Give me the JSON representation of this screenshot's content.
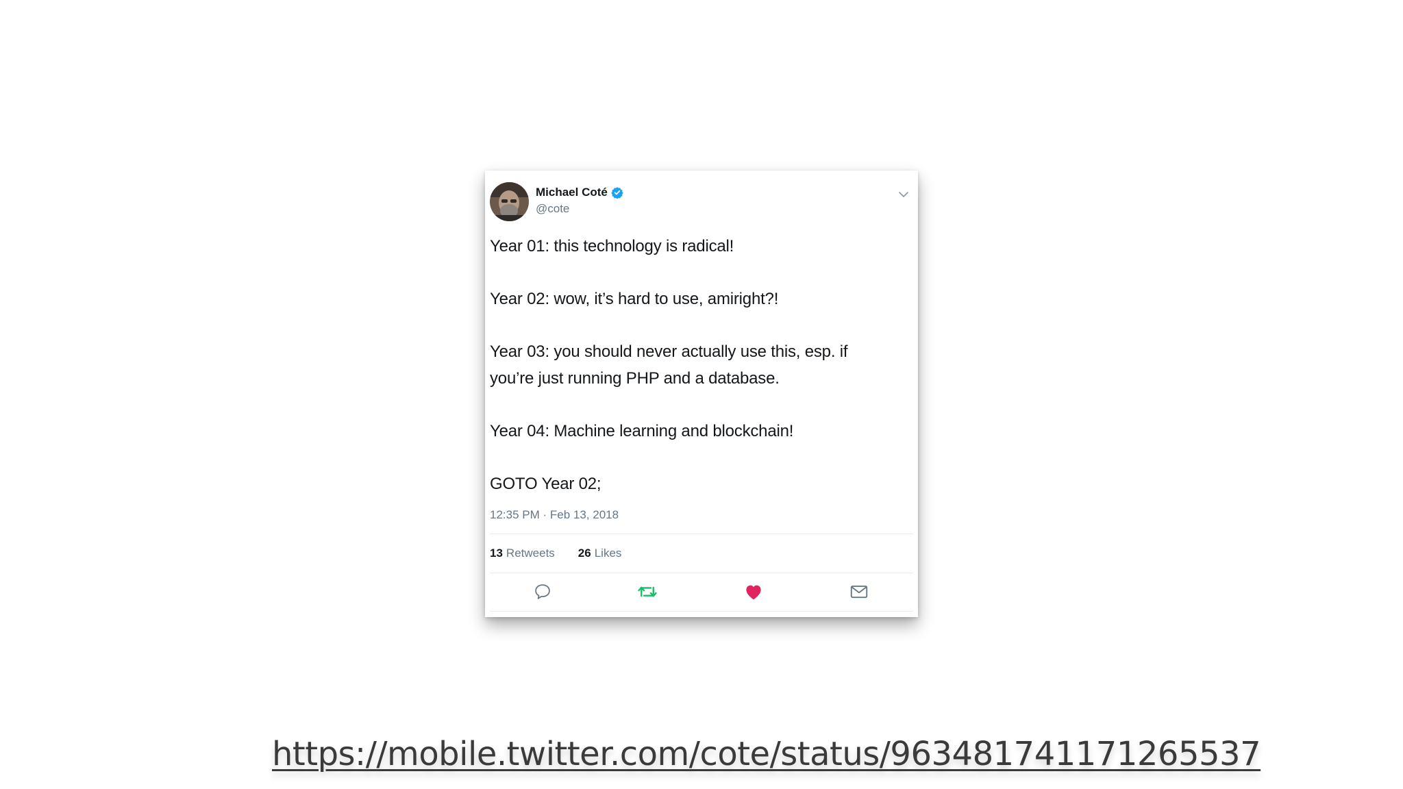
{
  "tweet": {
    "author_name": "Michael Coté",
    "handle": "@cote",
    "lines": [
      "Year 01: this technology is radical!",
      "",
      "Year 02: wow, it’s hard to use, amiright?!",
      "",
      "Year 03: you should never actually use this, esp. if",
      "you’re just running PHP and a database.",
      "",
      "Year 04: Machine learning and blockchain!",
      "",
      "GOTO Year 02;"
    ],
    "timestamp": "12:35 PM · Feb 13, 2018",
    "retweets_count": "13",
    "retweets_label": "Retweets",
    "likes_count": "26",
    "likes_label": "Likes",
    "liked": true,
    "icons": {
      "verified": "verified-badge-icon",
      "menu": "chevron-down-icon",
      "reply": "reply-bubble-icon",
      "retweet": "retweet-icon",
      "like": "heart-icon",
      "dm": "envelope-icon"
    },
    "colors": {
      "verified": "#1da1f2",
      "retweet": "#17bf63",
      "like": "#e0245e",
      "secondary_text": "#657786"
    }
  },
  "footer": {
    "url": "https://mobile.twitter.com/cote/status/963481741171265537"
  }
}
